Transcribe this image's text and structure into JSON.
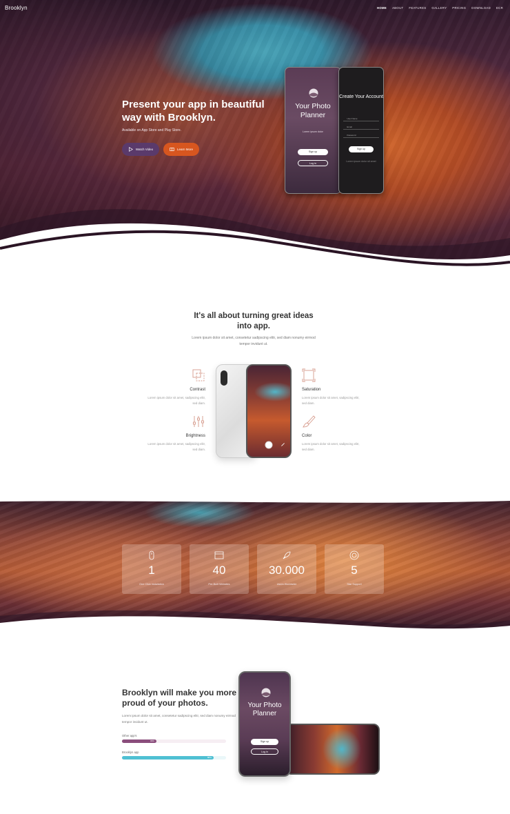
{
  "brand": "Brooklyn",
  "nav": [
    "HOME",
    "ABOUT",
    "FEATURES",
    "GALLERY",
    "PRICING",
    "DOWNLOAD",
    "ECR"
  ],
  "hero": {
    "title": "Present your app in beautiful way with Brooklyn.",
    "subtitle": "Available on App Store and Play Store.",
    "btn_video": "Watch Video",
    "btn_learn": "Learn More"
  },
  "hero_phone1": {
    "title": "Your Photo Planner",
    "tagline": "Lorem ipsum dolor",
    "signup": "Sign up",
    "login": "Log in"
  },
  "hero_phone2": {
    "title": "Create Your Account",
    "field1": "User Name",
    "field2": "Email",
    "field3": "Password",
    "signup": "Sign up",
    "note": "Lorem ipsum dolor sit amet"
  },
  "about": {
    "title": "It's all about turning great ideas into app.",
    "text": "Lorem ipsum dolor sit amet, consetetur sadipscing elitr, sed diam nonumy eirmod tempor invidunt ut."
  },
  "features": [
    {
      "title": "Contrast",
      "text": "Lorem ipsum dolor sit amet, sadipscing elitr, sed diam."
    },
    {
      "title": "Saturation",
      "text": "Lorem ipsum dolor sit amet, sadipscing elitr, sed diam."
    },
    {
      "title": "Brightness",
      "text": "Lorem ipsum dolor sit amet, sadipscing elitr, sed diam."
    },
    {
      "title": "Color",
      "text": "Lorem ipsum dolor sit amet, sadipscing elitr, sed diam."
    }
  ],
  "stats": [
    {
      "value": "1",
      "label": "One Click Installation",
      "icon": "mouse-icon"
    },
    {
      "value": "40",
      "label": "Pre-Built Websites",
      "icon": "browser-icon"
    },
    {
      "value": "30.000",
      "label": "Users Worldwide",
      "icon": "rocket-icon"
    },
    {
      "value": "5",
      "label": "Star Support",
      "icon": "lifebuoy-icon"
    }
  ],
  "proud": {
    "title": "Brooklyn will make you more proud of your photos.",
    "text": "Lorem ipsum dolor sit amet, consetetur sadipscing elitr, sed diam nonumy eirmod tempor invidunt ut.",
    "bars": [
      {
        "label": "Other app's",
        "value": "33%",
        "fraction": 0.33,
        "color": "#8a4d7c",
        "track": "#f6eef3"
      },
      {
        "label": "Brooklyn app",
        "value": "88%",
        "fraction": 0.88,
        "color": "#4fc0d3",
        "track": "#eaf7f9"
      }
    ]
  },
  "proud_phone": {
    "title": "Your Photo Planner",
    "signup": "Sign up",
    "login": "Log in"
  }
}
